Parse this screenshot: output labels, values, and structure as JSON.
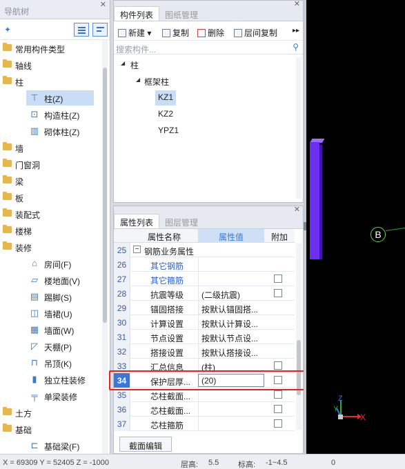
{
  "nav": {
    "title": "导航树",
    "items": [
      {
        "label": "常用构件类型",
        "level": 0
      },
      {
        "label": "轴线",
        "level": 0
      },
      {
        "label": "柱",
        "level": 0
      },
      {
        "label": "柱(Z)",
        "level": 1,
        "icon": "column-icon",
        "glyph": "⊤",
        "selected": true
      },
      {
        "label": "构造柱(Z)",
        "level": 1,
        "icon": "construct-column-icon",
        "glyph": "⊡"
      },
      {
        "label": "砌体柱(Z)",
        "level": 1,
        "icon": "masonry-column-icon",
        "glyph": "▥"
      },
      {
        "label": "墙",
        "level": 0
      },
      {
        "label": "门窗洞",
        "level": 0
      },
      {
        "label": "梁",
        "level": 0
      },
      {
        "label": "板",
        "level": 0
      },
      {
        "label": "装配式",
        "level": 0
      },
      {
        "label": "楼梯",
        "level": 0
      },
      {
        "label": "装修",
        "level": 0
      },
      {
        "label": "房间(F)",
        "level": 1,
        "icon": "room-icon",
        "glyph": "⌂"
      },
      {
        "label": "楼地面(V)",
        "level": 1,
        "icon": "floor-icon",
        "glyph": "▱"
      },
      {
        "label": "踢脚(S)",
        "level": 1,
        "icon": "skirting-icon",
        "glyph": "▤"
      },
      {
        "label": "墙裙(U)",
        "level": 1,
        "icon": "dado-icon",
        "glyph": "◫"
      },
      {
        "label": "墙面(W)",
        "level": 1,
        "icon": "wall-surface-icon",
        "glyph": "▦"
      },
      {
        "label": "天棚(P)",
        "level": 1,
        "icon": "ceiling-icon",
        "glyph": "◸"
      },
      {
        "label": "吊顶(K)",
        "level": 1,
        "icon": "suspended-ceiling-icon",
        "glyph": "⊓"
      },
      {
        "label": "独立柱装修",
        "level": 1,
        "icon": "column-finish-icon",
        "glyph": "▮"
      },
      {
        "label": "单梁装修",
        "level": 1,
        "icon": "beam-finish-icon",
        "glyph": "╤"
      },
      {
        "label": "土方",
        "level": 0
      },
      {
        "label": "基础",
        "level": 0
      },
      {
        "label": "基础梁(F)",
        "level": 1,
        "icon": "foundation-beam-icon",
        "glyph": "⊏"
      }
    ]
  },
  "comp": {
    "tabs": [
      "构件列表",
      "图纸管理"
    ],
    "toolbar": {
      "new": "新建",
      "copy": "复制",
      "delete": "删除",
      "floor_copy": "层间复制"
    },
    "search_placeholder": "搜索构件...",
    "tree": {
      "root": "柱",
      "group": "框架柱",
      "items": [
        {
          "label": "KZ1",
          "selected": true
        },
        {
          "label": "KZ2"
        },
        {
          "label": "YPZ1"
        }
      ]
    }
  },
  "prop": {
    "tabs": [
      "属性列表",
      "图层管理"
    ],
    "headers": {
      "name": "属性名称",
      "value": "属性值",
      "extra": "附加"
    },
    "rows": [
      {
        "num": "25",
        "name": "钢筋业务属性",
        "value": "",
        "check": false,
        "group": true
      },
      {
        "num": "26",
        "name": "其它钢筋",
        "value": "",
        "check": false,
        "blue": true
      },
      {
        "num": "27",
        "name": "其它箍筋",
        "value": "",
        "check": true,
        "blue": true
      },
      {
        "num": "28",
        "name": "抗震等级",
        "value": "(二级抗震)",
        "check": true
      },
      {
        "num": "29",
        "name": "锚固搭接",
        "value": "按默认锚固搭...",
        "check": false
      },
      {
        "num": "30",
        "name": "计算设置",
        "value": "按默认计算设...",
        "check": false
      },
      {
        "num": "31",
        "name": "节点设置",
        "value": "按默认节点设...",
        "check": false
      },
      {
        "num": "32",
        "name": "搭接设置",
        "value": "按默认搭接设...",
        "check": false
      },
      {
        "num": "33",
        "name": "汇总信息",
        "value": "(柱)",
        "check": true
      },
      {
        "num": "34",
        "name": "保护层厚...",
        "value": "(20)",
        "check": true,
        "selected": true
      },
      {
        "num": "35",
        "name": "芯柱截面...",
        "value": "",
        "check": true
      },
      {
        "num": "36",
        "name": "芯柱截面...",
        "value": "",
        "check": true
      },
      {
        "num": "37",
        "name": "芯柱箍筋",
        "value": "",
        "check": true
      }
    ],
    "edit_button": "截面编辑"
  },
  "view3d": {
    "axis_label": "B",
    "gizmo": {
      "x": "X",
      "y": "Y",
      "z": "Z"
    }
  },
  "status": {
    "coords": "X = 69309 Y = 52405 Z = -1000",
    "floor_height_label": "层高:",
    "floor_height": "5.5",
    "elevation_label": "标高:",
    "elevation": "-1~4.5",
    "zero": "0"
  },
  "colors": {
    "column": "#6b2ff0",
    "highlight": "#e52222",
    "accent": "#3a77d6"
  }
}
